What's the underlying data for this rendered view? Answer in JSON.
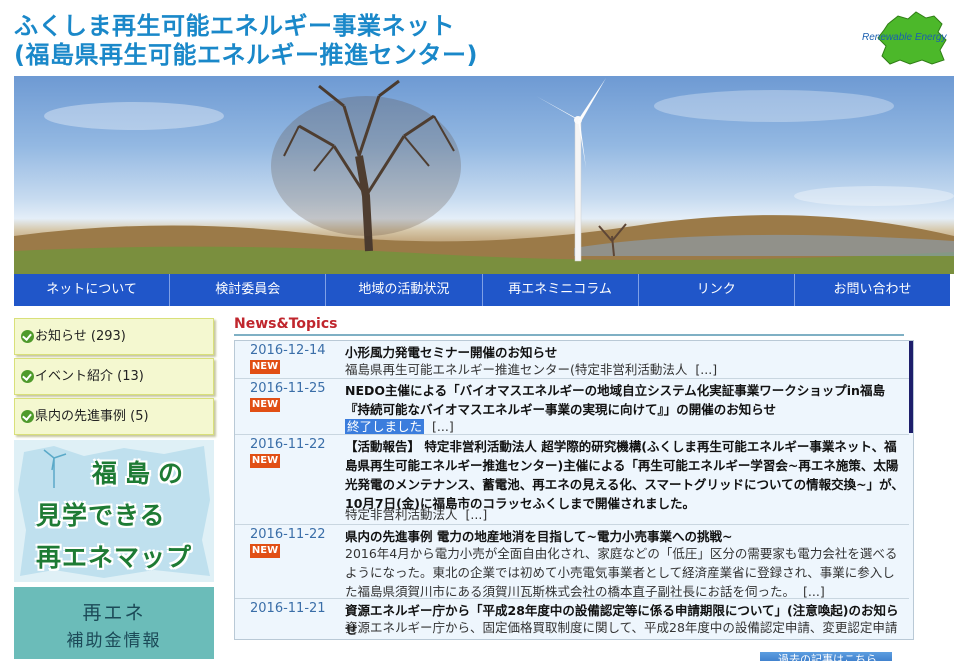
{
  "site": {
    "title_line1": "ふくしま再生可能エネルギー事業ネット",
    "title_line2": "(福島県再生可能エネルギー推進センター)",
    "logo_text": "Renewable Energy"
  },
  "nav": [
    {
      "label": "ネットについて"
    },
    {
      "label": "検討委員会"
    },
    {
      "label": "地域の活動状況"
    },
    {
      "label": "再エネミニコラム"
    },
    {
      "label": "リンク"
    },
    {
      "label": "お問い合わせ"
    }
  ],
  "sidebar": {
    "items": [
      {
        "label": "お知らせ (293)"
      },
      {
        "label": "イベント紹介 (13)"
      },
      {
        "label": "県内の先進事例 (5)"
      }
    ],
    "map_banner": {
      "line1": "福島の",
      "line2": "見学できる",
      "line3": "再エネマップ"
    },
    "subsidy_banner": {
      "line1": "再エネ",
      "line2": "補助金情報"
    }
  },
  "news": {
    "heading": "News&Topics",
    "new_label": "NEW",
    "items": [
      {
        "date": "2016-12-14",
        "title": "小形風力発電セミナー開催のお知らせ",
        "excerpt": "福島県再生可能エネルギー推進センター(特定非営利活動法人",
        "more": "[...]"
      },
      {
        "date": "2016-11-25",
        "title": "NEDO主催による「バイオマスエネルギーの地域自立システム化実証事業ワークショップin福島『持続可能なバイオマスエネルギー事業の実現に向けて』」の開催のお知らせ",
        "excerpt_highlight": "終了しました",
        "more": "[...]"
      },
      {
        "date": "2016-11-22",
        "title": "【活動報告】 特定非営利活動法人 超学際的研究機構(ふくしま再生可能エネルギー事業ネット、福島県再生可能エネルギー推進センター)主催による「再生可能エネルギー学習会~再エネ施策、太陽光発電のメンテナンス、蓄電池、再エネの見える化、スマートグリッドについての情報交換~」が、10月7日(金)に福島市のコラッセふくしまで開催されました。",
        "excerpt": "特定非営利活動法人",
        "more": "[...]"
      },
      {
        "date": "2016-11-22",
        "title": "県内の先進事例 電力の地産地消を目指して~電力小売事業への挑戦~",
        "excerpt": " 2016年4月から電力小売が全面自由化され、家庭などの「低圧」区分の需要家も電力会社を選べるようになった。東北の企業では初めて小売電気事業者として経済産業省に登録され、事業に参入した福島県須賀川市にある須賀川瓦斯株式会社の橋本直子副社長にお話を伺った。",
        "more": "[...]"
      },
      {
        "date": "2016-11-21",
        "title": "資源エネルギー庁から「平成28年度中の設備認定等に係る申請期限について」(注意喚起)のお知らせ",
        "excerpt": "資源エネルギー庁から、固定価格買取制度に関して、平成28年度中の設備認定申請、変更認定申請又は軽微変更届出を行う場合の申請期限等についてのお知らせが発表されています。",
        "more": "[...]"
      }
    ],
    "older_link": "過去の記事はこちら"
  }
}
